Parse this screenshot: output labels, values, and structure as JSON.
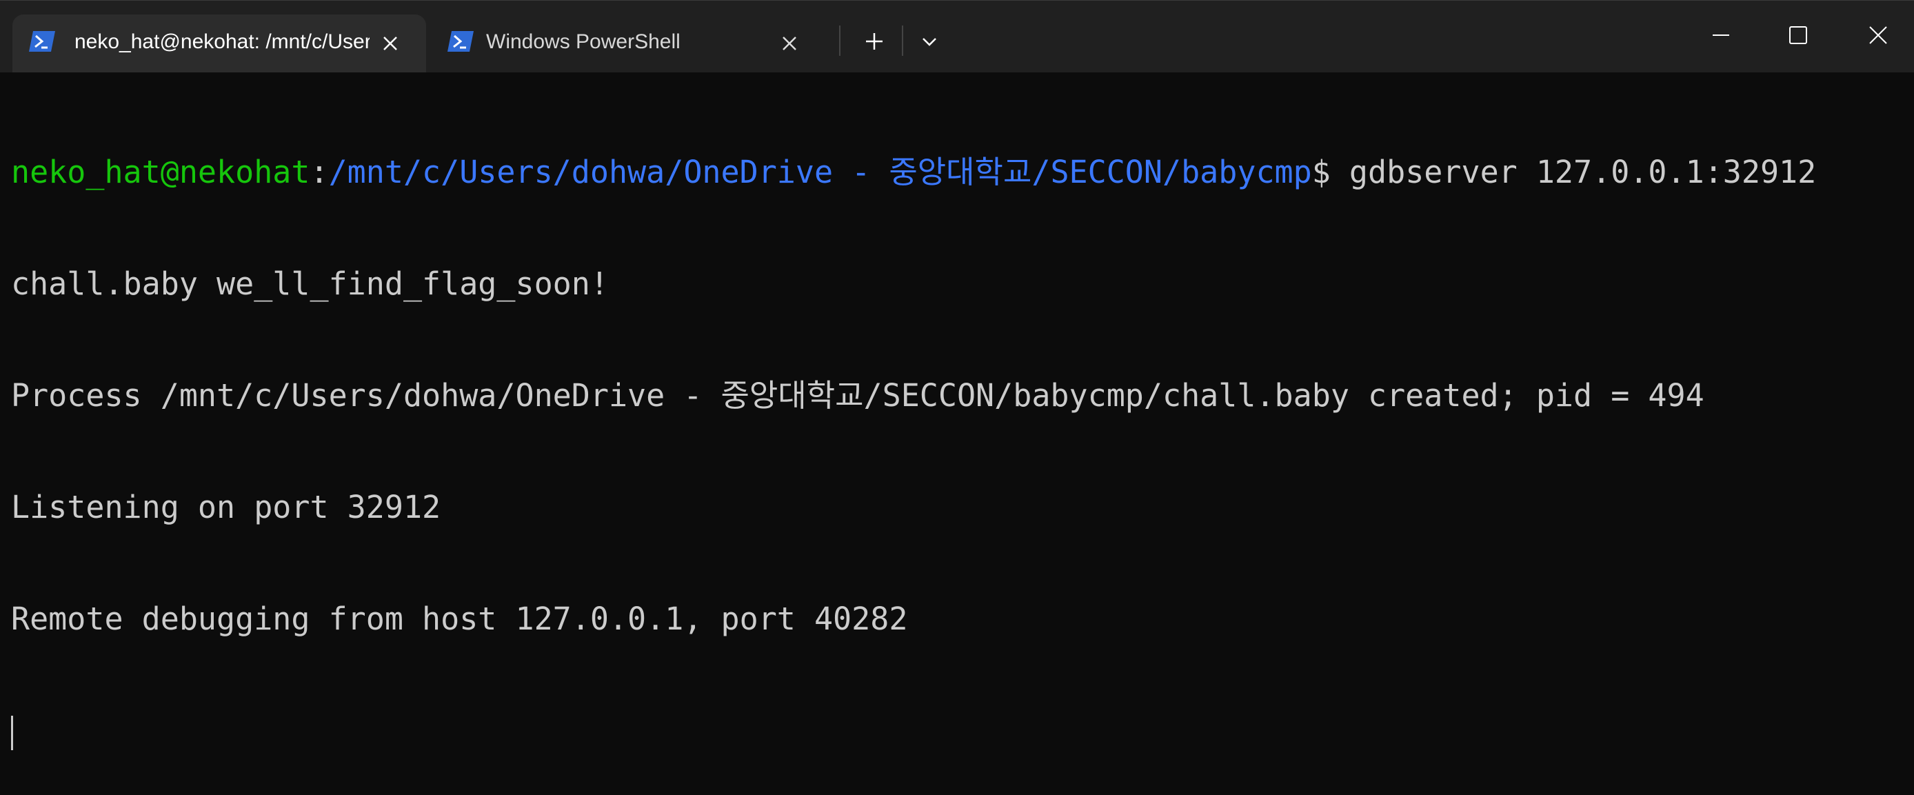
{
  "tabs": [
    {
      "label": "neko_hat@nekohat: /mnt/c/Users/dohwa/OneDrive - 중앙대학교/SECCON/babycmp",
      "icon": "powershell-icon",
      "active": true
    },
    {
      "label": "Windows PowerShell",
      "icon": "powershell-icon",
      "active": false
    }
  ],
  "toolbar": {
    "new_tab_icon": "plus-icon",
    "dropdown_icon": "chevron-down-icon"
  },
  "window_controls": {
    "minimize_icon": "minimize-icon",
    "maximize_icon": "maximize-icon",
    "close_icon": "close-icon"
  },
  "terminal": {
    "prompt_user": "neko_hat@nekohat",
    "prompt_sep": ":",
    "prompt_path": "/mnt/c/Users/dohwa/OneDrive - 중앙대학교/SECCON/babycmp",
    "prompt_symbol": "$ ",
    "command": "gdbserver 127.0.0.1:32912",
    "lines": [
      "chall.baby we_ll_find_flag_soon!",
      "Process /mnt/c/Users/dohwa/OneDrive - 중앙대학교/SECCON/babycmp/chall.baby created; pid = 494",
      "Listening on port 32912",
      "Remote debugging from host 127.0.0.1, port 40282"
    ]
  },
  "colors": {
    "background": "#0c0c0c",
    "titlebar": "#202020",
    "active_tab": "#2c2c2c",
    "user": "#16c60c",
    "path": "#3b78ff",
    "text": "#cccccc"
  }
}
